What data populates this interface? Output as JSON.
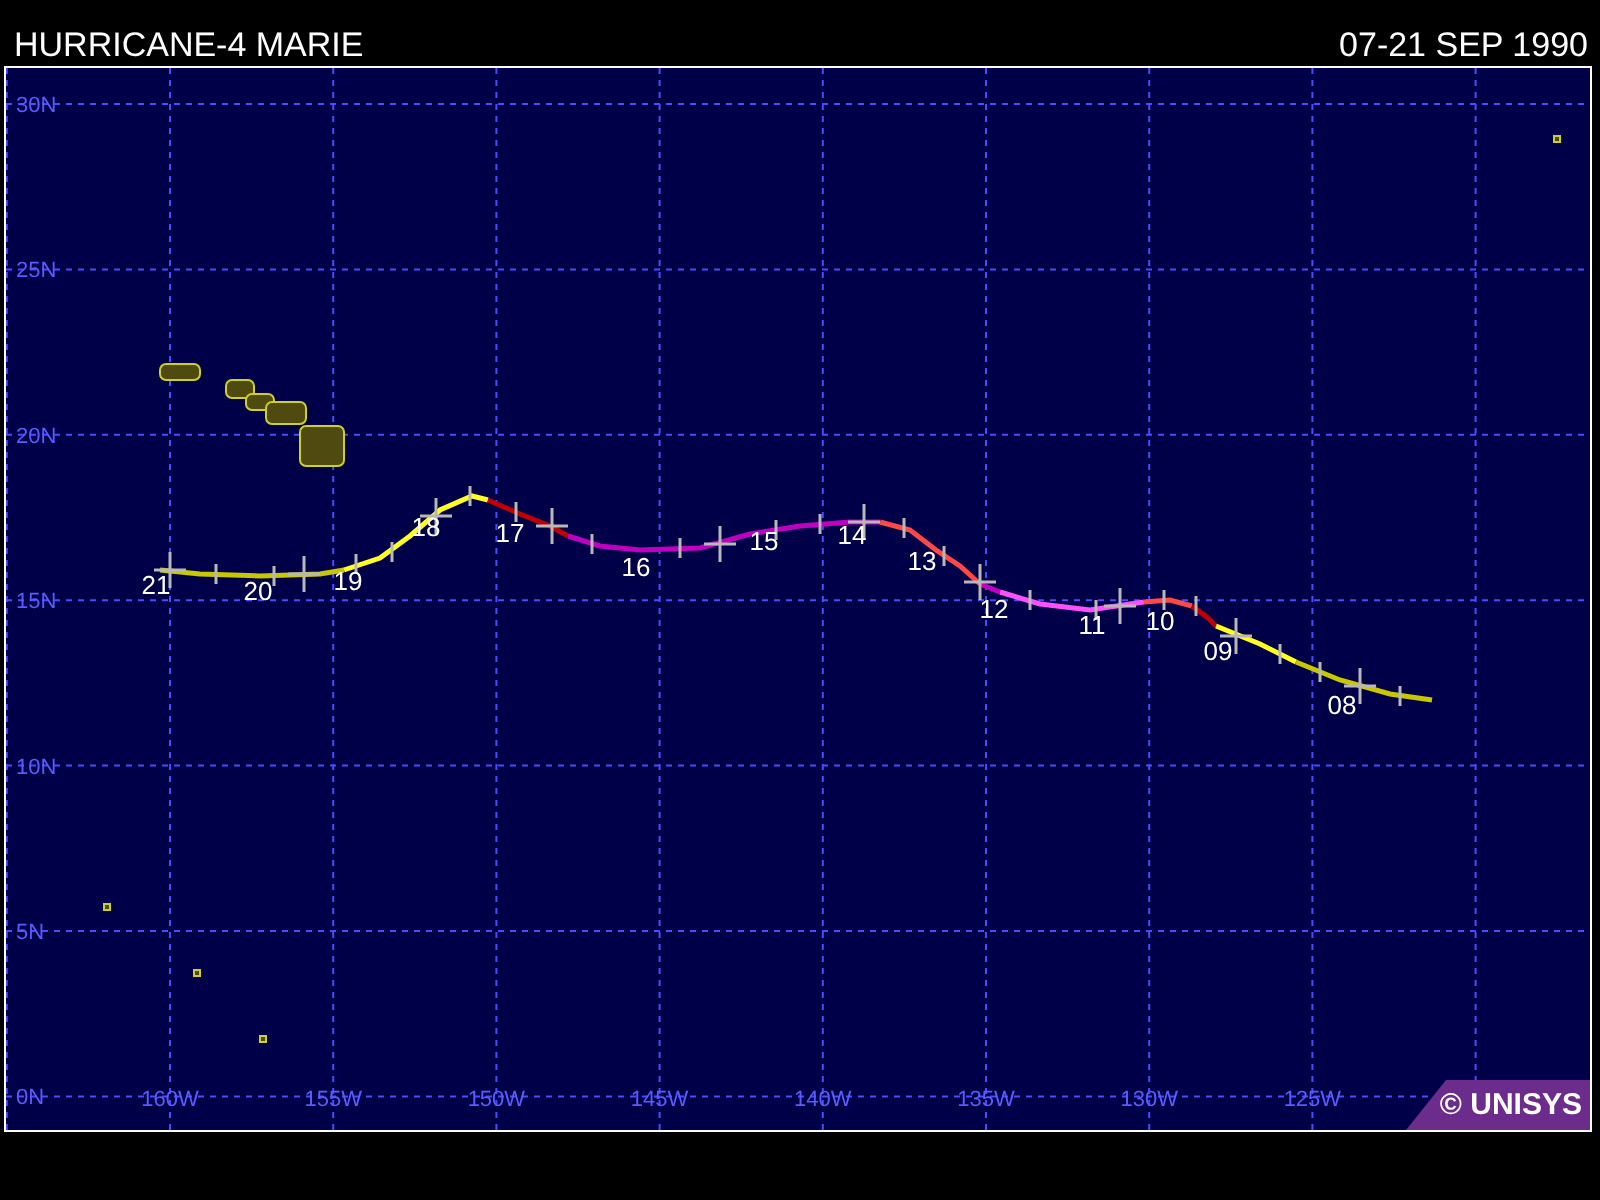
{
  "header": {
    "title": "HURRICANE-4 MARIE",
    "date_range": "07-21 SEP 1990"
  },
  "map": {
    "lat_labels": [
      "30N",
      "25N",
      "20N",
      "15N",
      "10N",
      "5N",
      "0N"
    ],
    "lon_labels": [
      "160W",
      "155W",
      "150W",
      "145W",
      "140W",
      "135W",
      "130W",
      "125W"
    ],
    "day_labels": [
      "21",
      "20",
      "19",
      "18",
      "17",
      "16",
      "15",
      "14",
      "13",
      "12",
      "11",
      "10",
      "09",
      "08"
    ],
    "credit": "© UNISYS"
  }
}
